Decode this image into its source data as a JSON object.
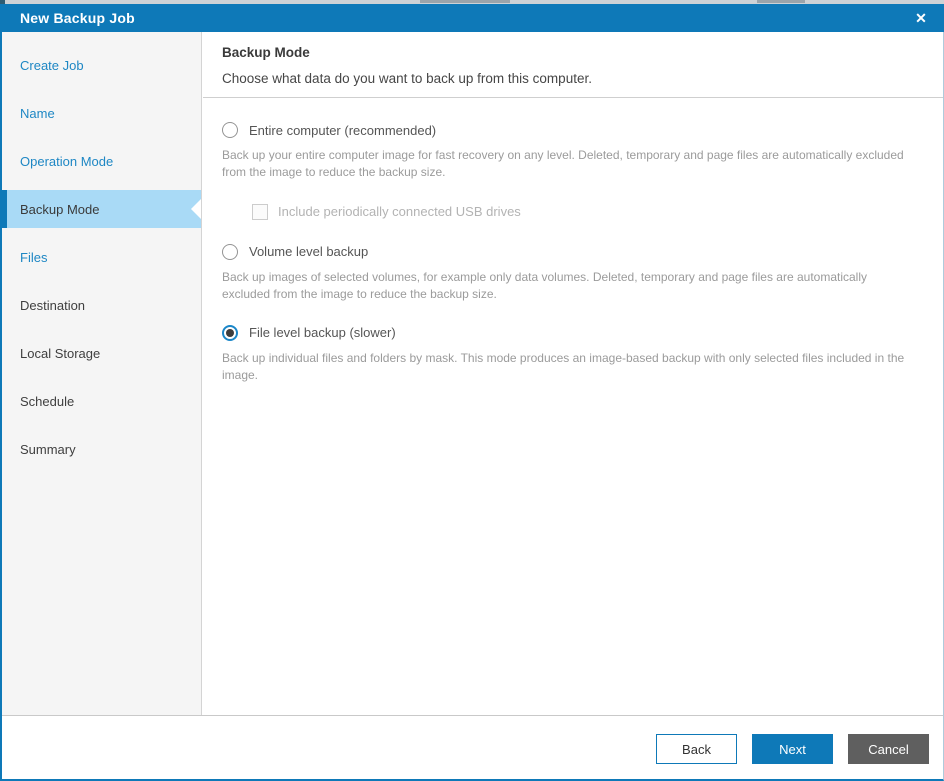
{
  "window": {
    "title": "New Backup Job",
    "close_icon": "✕"
  },
  "sidebar": {
    "items": [
      {
        "label": "Create Job",
        "state": "visited"
      },
      {
        "label": "Name",
        "state": "visited"
      },
      {
        "label": "Operation Mode",
        "state": "visited"
      },
      {
        "label": "Backup Mode",
        "state": "current"
      },
      {
        "label": "Files",
        "state": "visited"
      },
      {
        "label": "Destination",
        "state": "future"
      },
      {
        "label": "Local Storage",
        "state": "future"
      },
      {
        "label": "Schedule",
        "state": "future"
      },
      {
        "label": "Summary",
        "state": "future"
      }
    ]
  },
  "content": {
    "heading": "Backup Mode",
    "subheading": "Choose what data do you want to back up from this computer.",
    "options": [
      {
        "label": "Entire computer (recommended)",
        "selected": false,
        "description": "Back up your entire computer image for fast recovery on any level. Deleted, temporary and page files are automatically excluded from the image to reduce the backup size."
      },
      {
        "label": "Volume level backup",
        "selected": false,
        "description": "Back up images of selected volumes, for example only data volumes. Deleted, temporary and page files are automatically excluded from the image to reduce the backup size."
      },
      {
        "label": "File level backup (slower)",
        "selected": true,
        "description": "Back up individual files and folders by mask. This mode produces an image-based backup with only selected files included in the image."
      }
    ],
    "usb_checkbox": {
      "label": "Include periodically connected USB drives",
      "checked": false,
      "disabled": true
    }
  },
  "footer": {
    "back_label": "Back",
    "next_label": "Next",
    "cancel_label": "Cancel"
  },
  "colors": {
    "titlebar": "#0e79b8",
    "accent": "#0e79b8",
    "selected_item_bg": "#a9daf6",
    "link_text": "#1e87c4",
    "next_button": "#0e79b8",
    "cancel_button": "#5f5f5f"
  }
}
